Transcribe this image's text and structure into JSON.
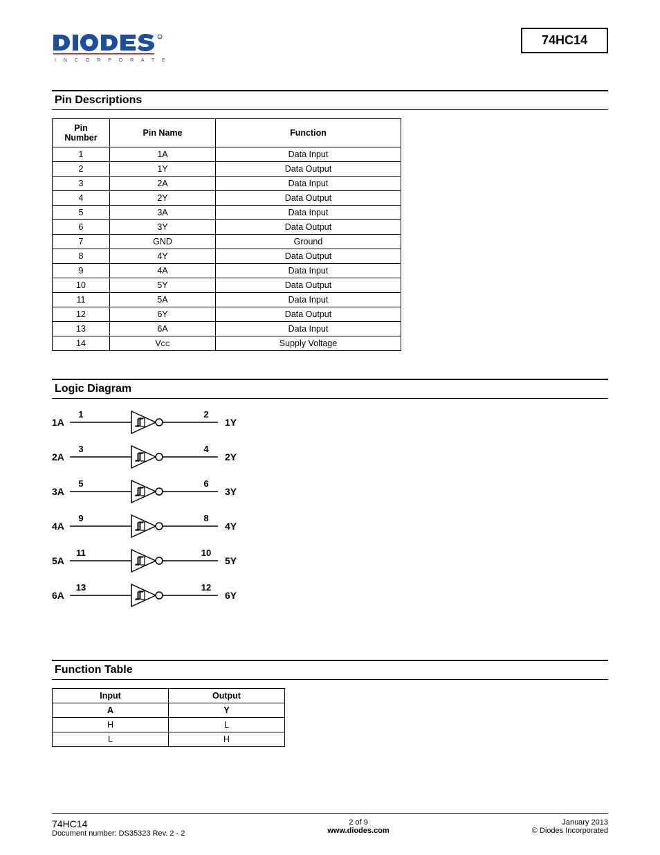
{
  "header": {
    "part": "74HC14",
    "logo_main": "DIODES",
    "logo_sub": "I N C O R P O R A T E D"
  },
  "sections": {
    "pin_desc_title": "Pin Descriptions",
    "logic_title": "Logic Diagram",
    "func_title": "Function Table"
  },
  "pin_table": {
    "headers": {
      "num": "Pin Number",
      "name": "Pin Name",
      "func": "Function"
    },
    "rows": [
      {
        "num": "1",
        "name": "1A",
        "func": "Data Input"
      },
      {
        "num": "2",
        "name": "1Y",
        "func": "Data Output"
      },
      {
        "num": "3",
        "name": "2A",
        "func": "Data Input"
      },
      {
        "num": "4",
        "name": "2Y",
        "func": "Data Output"
      },
      {
        "num": "5",
        "name": "3A",
        "func": "Data Input"
      },
      {
        "num": "6",
        "name": "3Y",
        "func": "Data Output"
      },
      {
        "num": "7",
        "name": "GND",
        "func": "Ground"
      },
      {
        "num": "8",
        "name": "4Y",
        "func": "Data Output"
      },
      {
        "num": "9",
        "name": "4A",
        "func": "Data Input"
      },
      {
        "num": "10",
        "name": "5Y",
        "func": "Data Output"
      },
      {
        "num": "11",
        "name": "5A",
        "func": "Data Input"
      },
      {
        "num": "12",
        "name": "6Y",
        "func": "Data Output"
      },
      {
        "num": "13",
        "name": "6A",
        "func": "Data Input"
      },
      {
        "num": "14",
        "name": "VCC",
        "func": "Supply Voltage"
      }
    ]
  },
  "logic_gates": [
    {
      "in_label": "1A",
      "in_pin": "1",
      "out_pin": "2",
      "out_label": "1Y"
    },
    {
      "in_label": "2A",
      "in_pin": "3",
      "out_pin": "4",
      "out_label": "2Y"
    },
    {
      "in_label": "3A",
      "in_pin": "5",
      "out_pin": "6",
      "out_label": "3Y"
    },
    {
      "in_label": "4A",
      "in_pin": "9",
      "out_pin": "8",
      "out_label": "4Y"
    },
    {
      "in_label": "5A",
      "in_pin": "11",
      "out_pin": "10",
      "out_label": "5Y"
    },
    {
      "in_label": "6A",
      "in_pin": "13",
      "out_pin": "12",
      "out_label": "6Y"
    }
  ],
  "function_table": {
    "headers": {
      "input": "Input",
      "output": "Output"
    },
    "subheaders": {
      "input": "A",
      "output": "Y"
    },
    "rows": [
      {
        "input": "H",
        "output": "L"
      },
      {
        "input": "L",
        "output": "H"
      }
    ]
  },
  "footer": {
    "part": "74HC14",
    "docnum": "Document number: DS35323  Rev. 2 - 2",
    "page": "2 of 9",
    "url": "www.diodes.com",
    "date": "January 2013",
    "copyright": "© Diodes Incorporated"
  }
}
